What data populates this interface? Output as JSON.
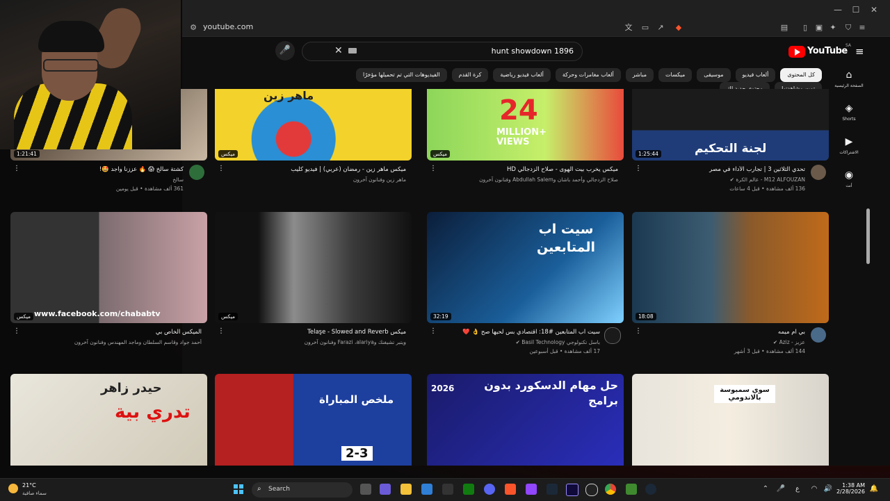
{
  "browser": {
    "url": "youtube.com",
    "window_controls": [
      "—",
      "☐",
      "✕"
    ]
  },
  "youtube": {
    "search_value": "hunt showdown 1896",
    "logo_text": "YouTube",
    "region": "SA",
    "chips": [
      "كل المحتوى",
      "ألعاب فيديو",
      "موسيقى",
      "ميكسات",
      "مباشر",
      "ألعاب مغامرات وحركة",
      "ألعاب فيديو رياضية",
      "كرة القدم",
      "الفيديوهات التي تم تحميلها مؤخرًا",
      "تمت مشاهدتها",
      "محتوى جديد لك"
    ],
    "guide": [
      {
        "icon": "⌂",
        "label": "الصفحة الرئيسية"
      },
      {
        "icon": "◈",
        "label": "Shorts"
      },
      {
        "icon": "▶",
        "label": "الاشتراكات"
      },
      {
        "icon": "◉",
        "label": "أنت"
      }
    ]
  },
  "videos": [
    {
      "title": "كشتة سالخ 😱 🔥 عززنا واجد 🤩!",
      "channel": "سالخ",
      "stats": "361 ألف مشاهدة • قبل يومين",
      "badge": "1:21:41"
    },
    {
      "title": "ميكس ماهر زين - رمضان (عربي) | فيديو كليب",
      "channel": "ماهر زين وفنانون آخرون",
      "stats": "",
      "badge": "ميكس",
      "overlay": "ماهر زين"
    },
    {
      "title": "ميكس يخرب بيت الهوى - صلاح الزدجالي HD",
      "channel": "صلاح الزدجالي وأحمد باشان وAbdullah Salem وفنانون آخرون",
      "stats": "",
      "badge": "ميكس",
      "overlay_big": "24",
      "overlay_small": "MILLION+ VIEWS"
    },
    {
      "title": "تحدي الثلاثين 3 | تجارب الأداء في مصر",
      "channel": "M12 ALFOUZAN - عالم الكرة ✔",
      "stats": "136 ألف مشاهدة • قبل 4 ساعات",
      "badge": "1:25:44",
      "overlay": "لجنة التحكيم"
    },
    {
      "title": "الميكس الخاص بي",
      "channel": "أحمد جواد وقاسم السلطان وماجد المهندس وفنانون آخرون",
      "stats": "",
      "badge": "ميكس",
      "overlay": "www.facebook.com/chababtv"
    },
    {
      "title": "ميكس Telaşe - Slowed and Reverb",
      "channel": "ويتبر تشيفنك وFarazi ،alariya وفنانون آخرون",
      "stats": "",
      "badge": "ميكس"
    },
    {
      "title": "سيت اب المتابعين #18: اقتصادي بس لحيها صح 👌 ❤️",
      "channel": "باسل تكنولوجي Basil Technology ✔",
      "stats": "17 ألف مشاهدة • قبل أسبوعين",
      "badge": "32:19",
      "overlay": "سيت اب المتابعين"
    },
    {
      "title": "بي ام ميمه",
      "channel": "عزيز - Aziz ✔",
      "stats": "144 ألف مشاهدة • قبل 3 أشهر",
      "badge": "18:08"
    },
    {
      "title": "",
      "channel": "",
      "stats": "",
      "badge": "",
      "overlay": "تدري بية",
      "overlay2": "حيدر زاهر"
    },
    {
      "title": "",
      "channel": "",
      "stats": "",
      "badge": "",
      "overlay": "ملخص المباراة",
      "score": "2-3"
    },
    {
      "title": "",
      "channel": "",
      "stats": "",
      "badge": "",
      "overlay": "حل مهام الدسكورد بدون برامج",
      "year": "2026"
    },
    {
      "title": "",
      "channel": "",
      "stats": "",
      "badge": "",
      "overlay": "سوي سمبوسة بالاندومي"
    }
  ],
  "taskbar": {
    "temp": "21°C",
    "weather_desc": "سماء صافية",
    "search_label": "Search",
    "time": "1:38 AM",
    "date": "2/28/2026",
    "lang": "ع"
  },
  "colors": {
    "accent": "#ff0000",
    "bg": "#0f0f0f",
    "chip": "#272727"
  }
}
